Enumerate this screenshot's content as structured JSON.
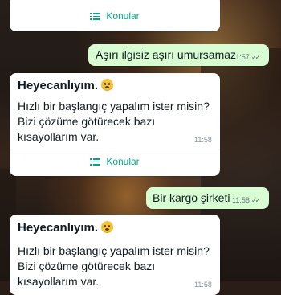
{
  "chat": {
    "top_card": {
      "action_label": "Konular",
      "action_icon": "list-icon"
    },
    "outgoing_1": {
      "text": "Aşırı ilgisiz aşırı umursamaz",
      "time": "11:57",
      "status": "read-double-check"
    },
    "incoming_1": {
      "title": "Heyecanlıyım.",
      "emoji": "upside-down-face",
      "text": "Hızlı bir başlangıç yapalım ister misin? Bizi çözüme götürecek bazı kısayollarım var.",
      "time": "11:58",
      "action_label": "Konular",
      "action_icon": "list-icon"
    },
    "outgoing_2": {
      "text": "Bir kargo şirketi",
      "time": "11:58",
      "status": "read-double-check"
    },
    "incoming_2": {
      "title": "Heyecanlıyım.",
      "emoji": "upside-down-face",
      "text": "Hızlı bir başlangıç yapalım ister misin? Bizi çözüme götürecek bazı kısayollarım var.",
      "time": "11:58"
    }
  },
  "colors": {
    "outgoing_bubble": "#d9fdd3",
    "incoming_bubble": "#ffffff",
    "accent": "#00a884"
  }
}
